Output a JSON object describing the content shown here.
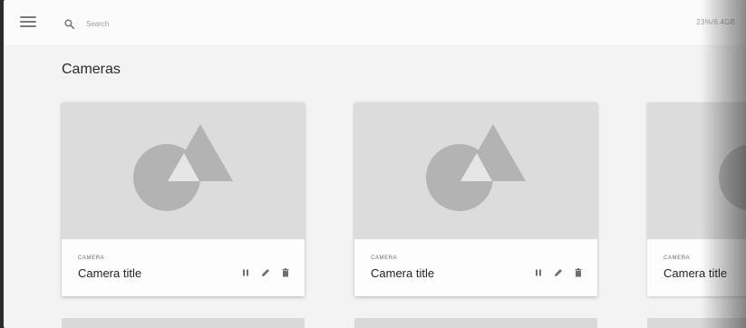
{
  "topbar": {
    "menu_icon": "hamburger-menu-icon",
    "search_icon": "search-icon",
    "search_placeholder": "Search",
    "usage": "23%/6.4GB"
  },
  "page_title": "Cameras",
  "cards": [
    {
      "overline": "CAMERA",
      "title": "Camera title"
    },
    {
      "overline": "CAMERA",
      "title": "Camera title"
    },
    {
      "overline": "CAMERA",
      "title": "Camera title"
    }
  ],
  "card_actions": [
    "pause-icon",
    "edit-pencil-icon",
    "delete-trash-icon"
  ],
  "colors": {
    "background": "#f3f3f4",
    "topbar": "#fbfbfb",
    "media_placeholder": "#dcdcdc",
    "placeholder_shape": "#b3b3b3",
    "icon": "#6f6f6f"
  }
}
